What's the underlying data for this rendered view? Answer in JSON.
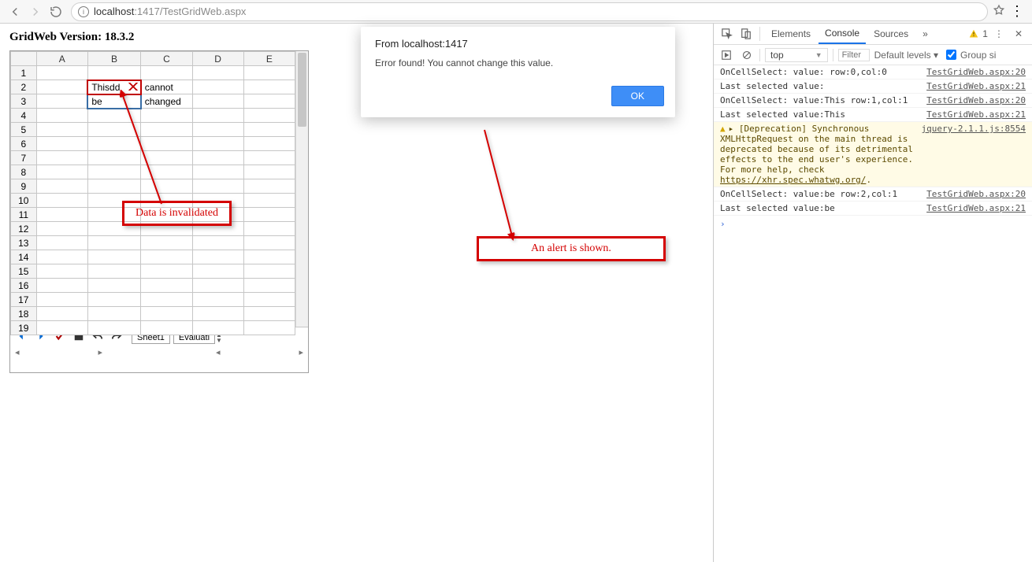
{
  "browser": {
    "url_host": "localhost",
    "url_port_path": ":1417/TestGridWeb.aspx"
  },
  "page": {
    "version_label": "GridWeb Version:",
    "version_value": "18.3.2"
  },
  "grid": {
    "columns": [
      "A",
      "B",
      "C",
      "D",
      "E"
    ],
    "row_count": 19,
    "cells": {
      "B2": "Thisdd",
      "C2": "cannot",
      "B3": "be",
      "C3": "changed"
    },
    "sheets": [
      "Sheet1",
      "Evaluati"
    ]
  },
  "alert": {
    "title": "From localhost:1417",
    "message": "Error found! You cannot change this value.",
    "ok": "OK"
  },
  "annotations": {
    "data": "Data is invalidated",
    "alert": "An alert is shown."
  },
  "devtools": {
    "tabs": [
      "Elements",
      "Console",
      "Sources"
    ],
    "more": "»",
    "warn_count": "1",
    "context": "top",
    "filter_placeholder": "Filter",
    "levels": "Default levels ▾",
    "group": "Group si",
    "lines": [
      {
        "msg": "OnCellSelect: value: row:0,col:0",
        "src": "TestGridWeb.aspx:20"
      },
      {
        "msg": "Last selected value:",
        "src": "TestGridWeb.aspx:21"
      },
      {
        "msg": "OnCellSelect: value:This row:1,col:1",
        "src": "TestGridWeb.aspx:20"
      },
      {
        "msg": "Last selected value:This",
        "src": "TestGridWeb.aspx:21"
      },
      {
        "warning": true,
        "msg": "▸ [Deprecation] Synchronous XMLHttpRequest on the main thread is deprecated because of its detrimental effects to the end user's experience. For more help, check ",
        "link": "https://xhr.spec.whatwg.org/",
        "src": "jquery-2.1.1.js:8554"
      },
      {
        "msg": "OnCellSelect: value:be row:2,col:1",
        "src": "TestGridWeb.aspx:20"
      },
      {
        "msg": "Last selected value:be",
        "src": "TestGridWeb.aspx:21"
      }
    ]
  }
}
